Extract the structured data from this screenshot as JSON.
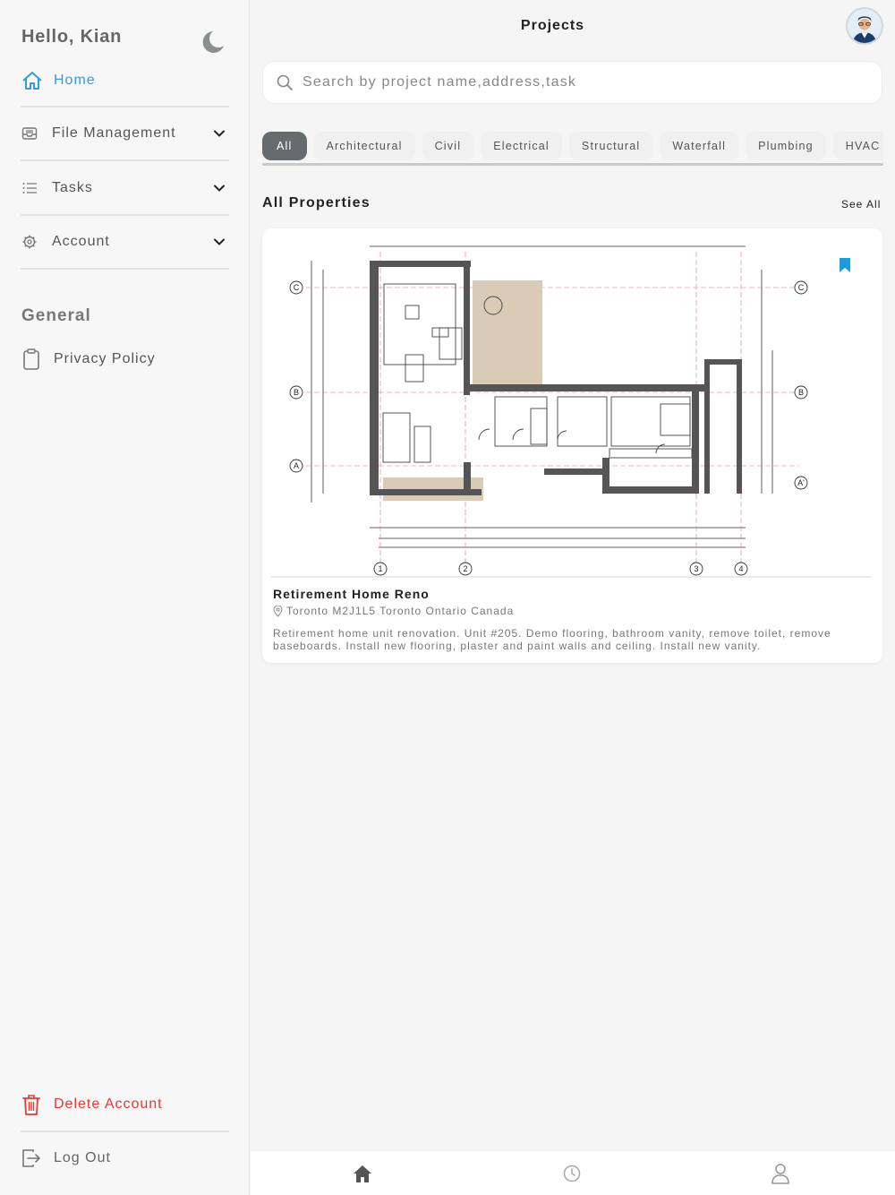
{
  "sidebar": {
    "greeting": "Hello, Kian",
    "home": "Home",
    "items": [
      {
        "label": "File Management"
      },
      {
        "label": "Tasks"
      },
      {
        "label": "Account"
      }
    ],
    "section_title": "General",
    "privacy": "Privacy Policy",
    "delete": "Delete Account",
    "logout": "Log Out"
  },
  "header": {
    "title": "Projects"
  },
  "search": {
    "placeholder": "Search by project name,address,task"
  },
  "filters": [
    "All",
    "Architectural",
    "Civil",
    "Electrical",
    "Structural",
    "Waterfall",
    "Plumbing",
    "HVAC"
  ],
  "properties": {
    "title": "All Properties",
    "see_all": "See All",
    "card": {
      "title": "Retirement Home Reno",
      "location": "Toronto M2J1L5 Toronto Ontario Canada",
      "description": "Retirement home unit renovation. Unit #205. Demo flooring, bathroom vanity, remove toilet, remove baseboards.  Install new flooring, plaster and paint walls and ceiling. Install new vanity.",
      "grid_labels": {
        "rows": [
          "C",
          "B",
          "A"
        ],
        "cols": [
          "1",
          "2",
          "3",
          "4"
        ],
        "row_prime": "A'"
      }
    }
  },
  "colors": {
    "accent": "#3a9ad9",
    "danger": "#e53935",
    "chip_active": "#666b6e"
  }
}
